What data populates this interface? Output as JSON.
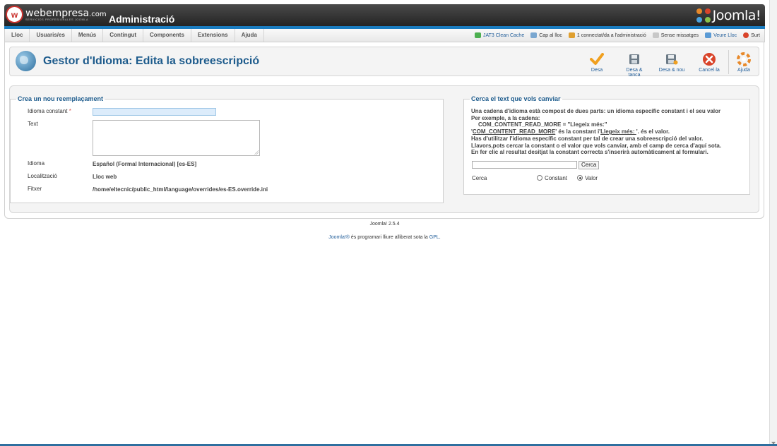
{
  "header": {
    "brand": "webempresa",
    "brand_suffix": ".com",
    "brand_tagline": "SERVICIOS PROFESIONALES JOOMLA",
    "admin_title": "Administració",
    "cms_logo_text": "Joomla!"
  },
  "menu": {
    "items": [
      "Lloc",
      "Usuaris/es",
      "Menús",
      "Contingut",
      "Components",
      "Extensions",
      "Ajuda"
    ]
  },
  "status": {
    "cache": "JAT3 Clean Cache",
    "goto_site": "Cap al lloc",
    "connected": "1 connectat/da a l'administració",
    "messages": "Sense missatges",
    "view_site": "Veure Lloc",
    "logout": "Surt"
  },
  "toolbar": {
    "title": "Gestor d'Idioma: Edita la sobreescripció",
    "save": "Desa",
    "save_close": "Desa & tanca",
    "save_new": "Desa & nou",
    "cancel": "Cancel·la",
    "help": "Ajuda"
  },
  "form": {
    "legend": "Crea un nou reemplaçament",
    "const_label": "Idioma constant",
    "required_mark": "*",
    "const_value": "",
    "text_label": "Text",
    "text_value": "",
    "language_label": "Idioma",
    "language_value": "Español (Formal Internacional) [es-ES]",
    "location_label": "Localització",
    "location_value": "Lloc web",
    "file_label": "Fitxer",
    "file_value": "/home/eltecnic/public_html/language/overrides/es-ES.override.ini"
  },
  "search": {
    "legend": "Cerca el text que vols canviar",
    "desc_line1": "Una cadena d'idioma està compost de dues parts: un idioma específic constant i el seu valor",
    "desc_line2": "Per exemple, a la cadena:",
    "desc_line3": "COM_CONTENT_READ_MORE = \"Llegeix més:\"",
    "desc_line4_a": "'",
    "desc_line4_b": "COM_CONTENT_READ_MORE",
    "desc_line4_c": "' és la constant i'",
    "desc_line4_d": "Llegeix més: ",
    "desc_line4_e": "'. és el valor.",
    "desc_line5": "Has d'utilitzar l'idioma específic constant per tal de crear una sobreescripció del valor.",
    "desc_line6": "Llavors,pots cercar la constant o el valor que vols canviar, amb el camp de cerca d'aquí sota.",
    "desc_line7": "En fer clic al resultat desitjat la constant correcta s'inserirà automàticament al formulari.",
    "input_value": "",
    "button": "Cerca",
    "scope_label": "Cerca",
    "option_constant": "Constant",
    "option_value": "Valor",
    "selected": "Valor"
  },
  "footer": {
    "version": "Joomla! 2.5.4",
    "license_link": "Joomla!®",
    "license_text": " és programari lliure alliberat sota la ",
    "license_gpl": "GPL",
    "license_end": "."
  },
  "colors": {
    "accent": "#1d5b8c",
    "header_stripe": "#1a7cc0",
    "save_green": "#f0a020",
    "cancel_red": "#d9442a",
    "help_orange": "#e8892a"
  }
}
